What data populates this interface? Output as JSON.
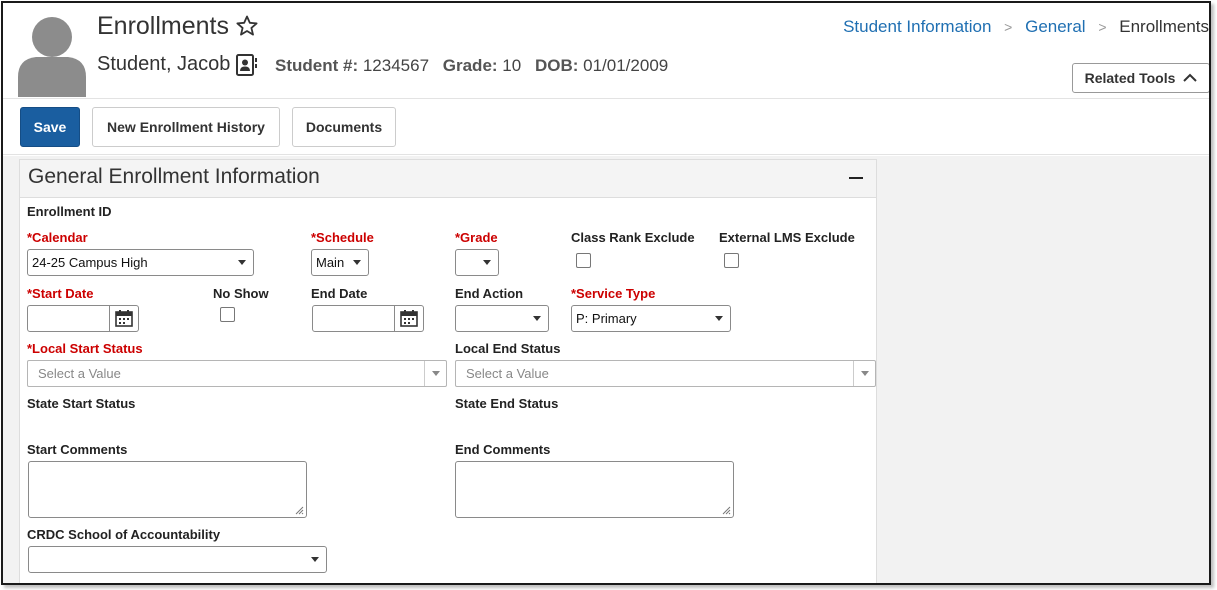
{
  "header": {
    "title": "Enrollments",
    "student_name": "Student, Jacob",
    "student_number_label": "Student #:",
    "student_number": "1234567",
    "grade_label": "Grade:",
    "grade": "10",
    "dob_label": "DOB:",
    "dob": "01/01/2009",
    "related_tools_label": "Related Tools"
  },
  "breadcrumb": {
    "items": [
      "Student Information",
      "General"
    ],
    "current": "Enrollments"
  },
  "toolbar": {
    "save_label": "Save",
    "new_history_label": "New Enrollment History",
    "documents_label": "Documents"
  },
  "panel": {
    "title": "General Enrollment Information",
    "enrollment_id_label": "Enrollment ID",
    "calendar_label": "*Calendar",
    "calendar_value": "24-25 Campus High",
    "schedule_label": "*Schedule",
    "schedule_value": "Main",
    "grade_label": "*Grade",
    "grade_value": "",
    "class_rank_exclude_label": "Class Rank Exclude",
    "external_lms_exclude_label": "External LMS Exclude",
    "start_date_label": "*Start Date",
    "no_show_label": "No Show",
    "end_date_label": "End Date",
    "end_action_label": "End Action",
    "end_action_value": "",
    "service_type_label": "*Service Type",
    "service_type_value": "P: Primary",
    "local_start_status_label": "*Local Start Status",
    "local_start_status_placeholder": "Select a Value",
    "local_end_status_label": "Local End Status",
    "local_end_status_placeholder": "Select a Value",
    "state_start_status_label": "State Start Status",
    "state_end_status_label": "State End Status",
    "start_comments_label": "Start Comments",
    "end_comments_label": "End Comments",
    "crdc_label": "CRDC School of Accountability",
    "crdc_value": ""
  },
  "colors": {
    "primary": "#1a5ea0",
    "link": "#1f6fb2",
    "required": "#cc0000"
  }
}
